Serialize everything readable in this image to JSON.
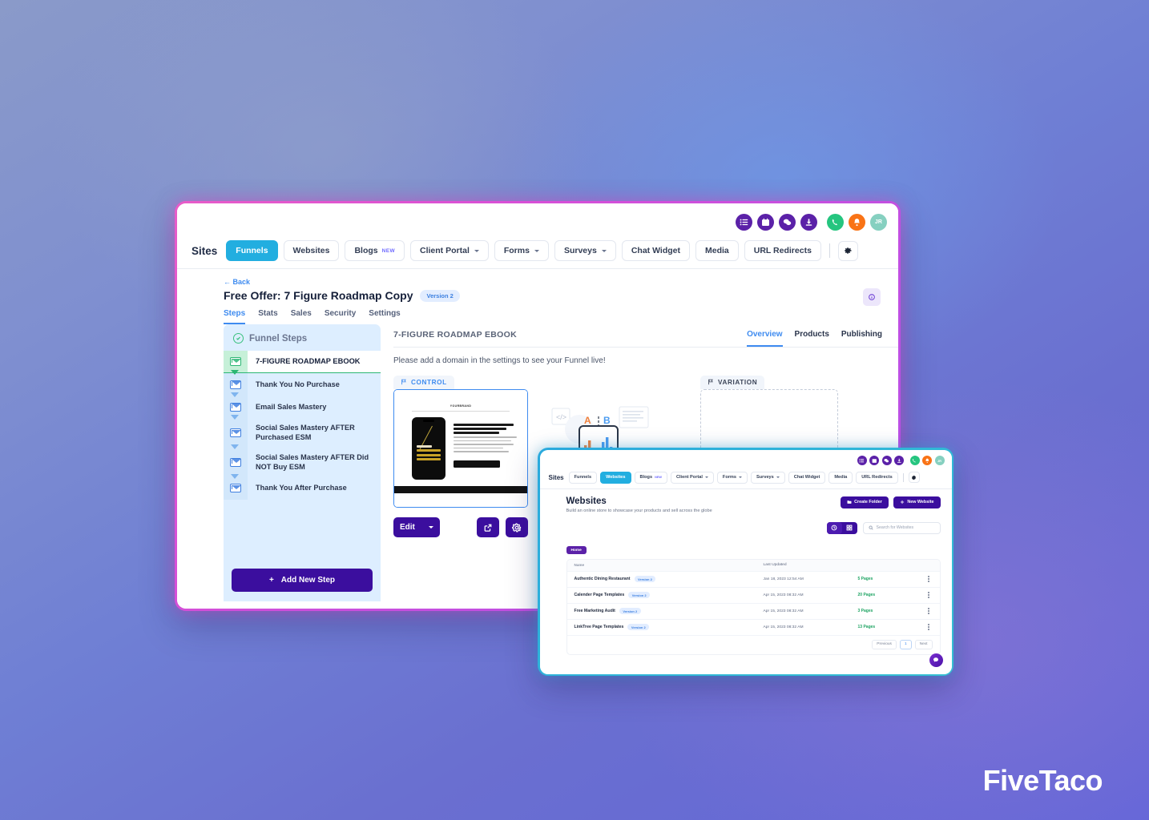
{
  "brand": {
    "name": "FiveTaco"
  },
  "main_window": {
    "header_icons": [
      {
        "name": "list-icon",
        "color": "#5b21a8"
      },
      {
        "name": "calendar-icon",
        "color": "#5b21a8"
      },
      {
        "name": "chat-icon",
        "color": "#5b21a8"
      },
      {
        "name": "download-icon",
        "color": "#5b21a8"
      },
      {
        "name": "phone-icon",
        "color": "#25c57f"
      },
      {
        "name": "bell-icon",
        "color": "#f97316"
      },
      {
        "name": "avatar",
        "color": "#86d0c0",
        "initials": "JR"
      }
    ],
    "nav": {
      "brand": "Sites",
      "items": [
        {
          "label": "Funnels",
          "active": true,
          "badge": "",
          "caret": false
        },
        {
          "label": "Websites",
          "active": false,
          "badge": "",
          "caret": false
        },
        {
          "label": "Blogs",
          "active": false,
          "badge": "NEW",
          "caret": false
        },
        {
          "label": "Client Portal",
          "active": false,
          "badge": "",
          "caret": true
        },
        {
          "label": "Forms",
          "active": false,
          "badge": "",
          "caret": true
        },
        {
          "label": "Surveys",
          "active": false,
          "badge": "",
          "caret": true
        },
        {
          "label": "Chat Widget",
          "active": false,
          "badge": "",
          "caret": false
        },
        {
          "label": "Media",
          "active": false,
          "badge": "",
          "caret": false
        },
        {
          "label": "URL Redirects",
          "active": false,
          "badge": "",
          "caret": false
        }
      ]
    },
    "page": {
      "back_label": "← Back",
      "title": "Free Offer: 7 Figure Roadmap Copy",
      "version_badge": "Version 2",
      "subtabs": [
        {
          "label": "Steps",
          "active": true
        },
        {
          "label": "Stats",
          "active": false
        },
        {
          "label": "Sales",
          "active": false
        },
        {
          "label": "Security",
          "active": false
        },
        {
          "label": "Settings",
          "active": false
        }
      ]
    },
    "funnel_steps": {
      "title": "Funnel Steps",
      "items": [
        {
          "label": "7-FIGURE ROADMAP EBOOK",
          "active": true
        },
        {
          "label": "Thank You No Purchase",
          "active": false
        },
        {
          "label": "Email Sales Mastery",
          "active": false
        },
        {
          "label": "Social Sales Mastery AFTER Purchased ESM",
          "active": false
        },
        {
          "label": "Social Sales Mastery AFTER Did NOT Buy ESM",
          "active": false
        },
        {
          "label": "Thank You After Purchase",
          "active": false
        }
      ],
      "add_button": "Add New Step"
    },
    "content": {
      "step_title": "7-FIGURE ROADMAP EBOOK",
      "tabs": [
        {
          "label": "Overview",
          "active": true
        },
        {
          "label": "Products",
          "active": false
        },
        {
          "label": "Publishing",
          "active": false
        }
      ],
      "domain_notice": "Please add a domain in the settings to see your Funnel live!",
      "control_tag": "CONTROL",
      "variation_tag": "VARIATION",
      "edit_button": "Edit"
    }
  },
  "second_window": {
    "header_icons": [
      {
        "name": "list-icon"
      },
      {
        "name": "calendar-icon"
      },
      {
        "name": "chat-icon"
      },
      {
        "name": "download-icon"
      },
      {
        "name": "phone-icon"
      },
      {
        "name": "bell-icon"
      },
      {
        "name": "avatar"
      }
    ],
    "nav": {
      "brand": "Sites",
      "items": [
        {
          "label": "Funnels",
          "active": false,
          "badge": "",
          "caret": false
        },
        {
          "label": "Websites",
          "active": true,
          "badge": "",
          "caret": false
        },
        {
          "label": "Blogs",
          "active": false,
          "badge": "NEW",
          "caret": false
        },
        {
          "label": "Client Portal",
          "active": false,
          "badge": "",
          "caret": true
        },
        {
          "label": "Forms",
          "active": false,
          "badge": "",
          "caret": true
        },
        {
          "label": "Surveys",
          "active": false,
          "badge": "",
          "caret": true
        },
        {
          "label": "Chat Widget",
          "active": false,
          "badge": "",
          "caret": false
        },
        {
          "label": "Media",
          "active": false,
          "badge": "",
          "caret": false
        },
        {
          "label": "URL Redirects",
          "active": false,
          "badge": "",
          "caret": false
        }
      ]
    },
    "page": {
      "title": "Websites",
      "subtitle": "Build an online store to showcase your products and sell across the globe",
      "create_folder_label": "Create Folder",
      "new_website_label": "New Website",
      "search_placeholder": "Search for Websites",
      "breadcrumb": "Home"
    },
    "table": {
      "columns": [
        "Name",
        "Last Updated"
      ],
      "rows": [
        {
          "name": "Authentic Dining Restaurant",
          "version": "Version 2",
          "updated": "Jan 18, 2023 12:54 AM",
          "pages": "5 Pages"
        },
        {
          "name": "Calender Page Templates",
          "version": "Version 2",
          "updated": "Apr 15, 2023 08:32 AM",
          "pages": "20 Pages"
        },
        {
          "name": "Free Marketing Audit",
          "version": "Version 2",
          "updated": "Apr 15, 2023 08:32 AM",
          "pages": "3 Pages"
        },
        {
          "name": "LinkTree Page Templates",
          "version": "Version 2",
          "updated": "Apr 15, 2023 08:32 AM",
          "pages": "13 Pages"
        }
      ]
    },
    "pagination": {
      "previous": "Previous",
      "current": "1",
      "next": "Next"
    }
  }
}
